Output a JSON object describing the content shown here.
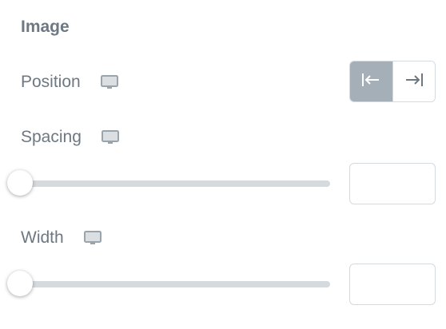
{
  "section": {
    "title": "Image"
  },
  "controls": {
    "position": {
      "label": "Position",
      "device_icon": "desktop-monitor-icon",
      "options": [
        {
          "name": "align-start",
          "icon": "arrow-left-bar-icon",
          "active": true
        },
        {
          "name": "align-end",
          "icon": "arrow-right-bar-icon",
          "active": false
        }
      ]
    },
    "spacing": {
      "label": "Spacing",
      "device_icon": "desktop-monitor-icon",
      "slider_value": 0,
      "input_value": "",
      "input_placeholder": ""
    },
    "width": {
      "label": "Width",
      "device_icon": "desktop-monitor-icon",
      "slider_value": 0,
      "input_value": "",
      "input_placeholder": ""
    }
  },
  "colors": {
    "label_text": "#6d7882",
    "active_choice_bg": "#a4afb7",
    "track": "#d5dadf",
    "border": "#d5dadf"
  }
}
